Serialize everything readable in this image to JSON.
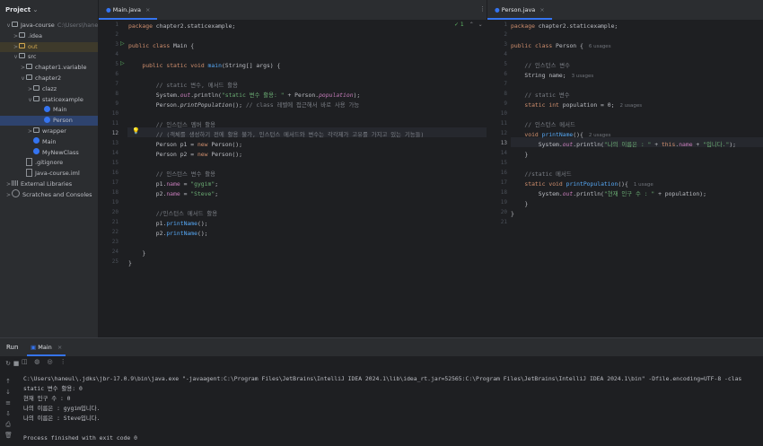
{
  "project": {
    "title": "Project",
    "tree": [
      {
        "label": "Java-course",
        "note": "C:\\Users\\haneul\\",
        "arrow": "v",
        "icon": "folder"
      },
      {
        "label": ".idea",
        "arrow": ">",
        "icon": "folder"
      },
      {
        "label": "out",
        "arrow": ">",
        "icon": "folder-out"
      },
      {
        "label": "src",
        "arrow": "v",
        "icon": "folder"
      },
      {
        "label": "chapter1.variable",
        "arrow": ">",
        "icon": "package"
      },
      {
        "label": "chapter2",
        "arrow": "v",
        "icon": "package"
      },
      {
        "label": "clazz",
        "arrow": ">",
        "icon": "package"
      },
      {
        "label": "staticexample",
        "arrow": "v",
        "icon": "package"
      },
      {
        "label": "Main",
        "arrow": "",
        "icon": "class"
      },
      {
        "label": "Person",
        "arrow": "",
        "icon": "class"
      },
      {
        "label": "wrapper",
        "arrow": ">",
        "icon": "package"
      },
      {
        "label": "Main",
        "arrow": "",
        "icon": "class"
      },
      {
        "label": "MyNewClass",
        "arrow": "",
        "icon": "class"
      },
      {
        "label": ".gitignore",
        "arrow": "",
        "icon": "file"
      },
      {
        "label": "Java-course.iml",
        "arrow": "",
        "icon": "file"
      },
      {
        "label": "External Libraries",
        "arrow": ">",
        "icon": "library"
      },
      {
        "label": "Scratches and Consoles",
        "arrow": ">",
        "icon": "scratch"
      }
    ]
  },
  "left_editor": {
    "tab": "Main.java",
    "inspection": "✓ 1",
    "line_numbers": [
      "1",
      "2",
      "3",
      "4",
      "5",
      "6",
      "7",
      "8",
      "9",
      "10",
      "11",
      "12",
      "13",
      "14",
      "15",
      "16",
      "17",
      "18",
      "19",
      "20",
      "21",
      "22",
      "23",
      "24",
      "25"
    ],
    "lines": [
      "package chapter2.staticexample;",
      "",
      "public class Main {",
      "",
      "    public static void main(String[] args) {",
      "",
      "        // static 변수, 메서드 활용",
      "        System.out.println(\"static 변수 활용: \" + Person.population);",
      "        Person.printPopulation(); // class 레벨에 접근해서 바로 사용 가능",
      "",
      "        // 인스턴스 멤버 활용",
      "        // (객체를 생성하기 전에 활용 불가, 인스턴스 메서드와 변수는 각각제가 고유를 가지고 있는 기능들)",
      "        Person p1 = new Person();",
      "        Person p2 = new Person();",
      "",
      "        // 인스턴스 변수 활용",
      "        p1.name = \"gygim\";",
      "        p2.name = \"Steve\";",
      "",
      "        //인스턴스 메서드 활용",
      "        p1.printName();",
      "        p2.printName();",
      "",
      "    }",
      "}"
    ]
  },
  "right_editor": {
    "tab": "Person.java",
    "line_numbers": [
      "1",
      "2",
      "3",
      "4",
      "5",
      "6",
      "7",
      "8",
      "9",
      "10",
      "11",
      "12",
      "13",
      "14",
      "15",
      "16",
      "17",
      "18",
      "19",
      "20",
      "21"
    ],
    "lines": [
      "package chapter2.staticexample;",
      "",
      "public class Person {",
      "",
      "    // 인스턴스 변수",
      "    String name;",
      "",
      "    // static 변수",
      "    static int population = 0;",
      "",
      "    // 인스턴스 메서드",
      "    void printName(){",
      "        System.out.println(\"나의 이름은 : \" + this.name + \"입니다.\");",
      "    }",
      "",
      "    //static 메서드",
      "    static void printPopulation(){",
      "        System.out.println(\"현재 인구 수 : \" + population);",
      "    }",
      "}",
      ""
    ],
    "usages": {
      "class": "6 usages",
      "name": "3 usages",
      "population": "2 usages",
      "printName": "2 usages",
      "printPopulation": "1 usage"
    }
  },
  "run_panel": {
    "label": "Run",
    "tab": "Main",
    "console": [
      "C:\\Users\\haneul\\.jdks\\jbr-17.0.9\\bin\\java.exe \"-javaagent:C:\\Program Files\\JetBrains\\IntelliJ IDEA 2024.1\\lib\\idea_rt.jar=52565:C:\\Program Files\\JetBrains\\IntelliJ IDEA 2024.1\\bin\" -Dfile.encoding=UTF-8 -clas",
      "static 변수 활용: 0",
      "현재 인구 수 : 0",
      "나의 이름은 : gygim입니다.",
      "나의 이름은 : Steve입니다.",
      "",
      "Process finished with exit code 0"
    ]
  }
}
